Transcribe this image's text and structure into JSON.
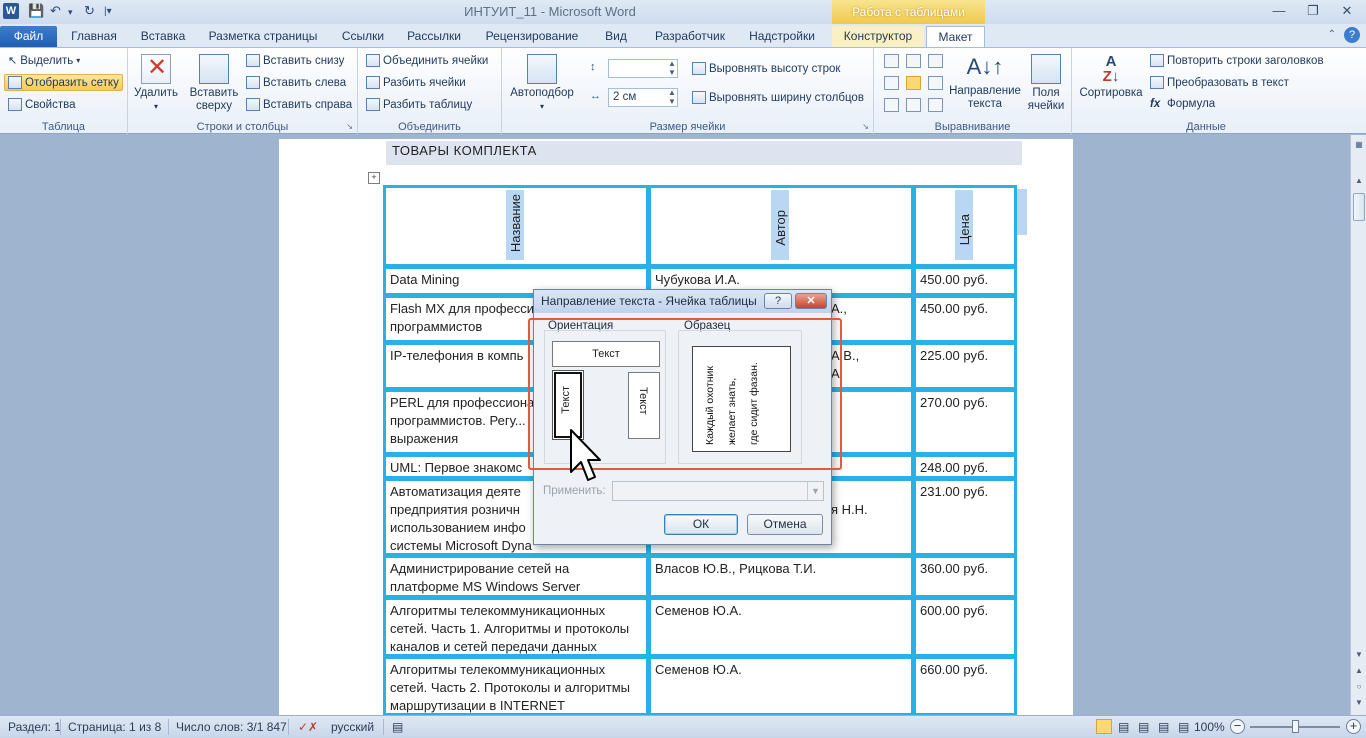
{
  "titlebar": {
    "app_icon": "W",
    "title": "ИНТУИТ_11  -  Microsoft Word",
    "context_tab": "Работа с таблицами",
    "qat_icons": [
      "save-icon",
      "undo-icon",
      "redo-icon",
      "customize-icon"
    ]
  },
  "tabs": {
    "file": "Файл",
    "home": "Главная",
    "insert": "Вставка",
    "layout_page": "Разметка страницы",
    "references": "Ссылки",
    "mailings": "Рассылки",
    "review": "Рецензирование",
    "view": "Вид",
    "developer": "Разработчик",
    "addins": "Надстройки",
    "design": "Конструктор",
    "layout": "Макет"
  },
  "ribbon": {
    "table": {
      "select": "Выделить",
      "gridlines": "Отобразить сетку",
      "properties": "Свойства",
      "label": "Таблица"
    },
    "rows_cols": {
      "delete": "Удалить",
      "insert_above_1": "Вставить",
      "insert_above_2": "сверху",
      "insert_below": "Вставить снизу",
      "insert_left": "Вставить слева",
      "insert_right": "Вставить справа",
      "label": "Строки и столбцы"
    },
    "merge": {
      "merge_cells": "Объединить ячейки",
      "split_cells": "Разбить ячейки",
      "split_table": "Разбить таблицу",
      "label": "Объединить"
    },
    "cell_size": {
      "autofit": "Автоподбор",
      "height_value": "",
      "width_value": "2 см",
      "distribute_rows": "Выровнять высоту строк",
      "distribute_cols": "Выровнять ширину столбцов",
      "label": "Размер ячейки"
    },
    "alignment": {
      "text_direction_1": "Направление",
      "text_direction_2": "текста",
      "margins_1": "Поля",
      "margins_2": "ячейки",
      "label": "Выравнивание"
    },
    "data": {
      "sort": "Сортировка",
      "repeat_header": "Повторить строки заголовков",
      "convert": "Преобразовать в текст",
      "formula": "Формула",
      "label": "Данные"
    }
  },
  "document": {
    "heading": "ТОВАРЫ КОМПЛЕКТА",
    "headers": [
      "Название",
      "Автор",
      "Цена"
    ],
    "rows": [
      {
        "name": "Data Mining",
        "author": "Чубукова И.А.",
        "price": "450.00 руб."
      },
      {
        "name": "Flash MX для професси... программистов",
        "author": "...",
        "price": "450.00 руб."
      },
      {
        "name": "IP-телефония в компь...",
        "author": "...А.В., ...А.",
        "price": "225.00 руб."
      },
      {
        "name": "PERL для профессиона... программистов. Регу... выражения",
        "author": "",
        "price": "270.00 руб."
      },
      {
        "name": "UML: Первое знакомс...",
        "author": "",
        "price": "248.00 руб."
      },
      {
        "name": "Автоматизация деяте... предприятия розничн... использованием инфо... системы Microsoft Dyna...",
        "author": "... ...я Н.Н.",
        "price": "231.00 руб."
      },
      {
        "name": "Администрирование сетей на платформе MS Windows Server",
        "author": "Власов Ю.В., Рицкова Т.И.",
        "price": "360.00 руб."
      },
      {
        "name": "Алгоритмы телекоммуникационных сетей. Часть 1. Алгоритмы и протоколы каналов и сетей передачи данных",
        "author": "Семенов Ю.А.",
        "price": "600.00 руб."
      },
      {
        "name": "Алгоритмы телекоммуникационных сетей. Часть 2. Протоколы и алгоритмы маршрутизации в INTERNET",
        "author": "Семенов Ю.А.",
        "price": "660.00 руб."
      }
    ],
    "cells": {
      "r1_name": "Data Mining",
      "r1_author": "Чубукова И.А.",
      "r1_price": "450.00 руб.",
      "r2_name_1": "Flash MX для професси",
      "r2_name_2": "программистов",
      "r2_author": "А.,",
      "r2_price": "450.00 руб.",
      "r3_name": "IP-телефония в компь",
      "r3_author_1": "А.В.,",
      "r3_author_2": "А.",
      "r3_price": "225.00 руб.",
      "r4_name_1": "PERL для профессиона",
      "r4_name_2": "программистов. Регу...",
      "r4_name_3": "выражения",
      "r4_price": "270.00 руб.",
      "r5_name": "UML: Первое знакомс",
      "r5_price": "248.00 руб.",
      "r6_name_1": "Автоматизация деяте",
      "r6_name_2": "предприятия розничн",
      "r6_name_3": "использованием инфо",
      "r6_name_4": "системы Microsoft Dyna",
      "r6_author_1": "",
      "r6_author_2": "я Н.Н.",
      "r6_price": "231.00 руб.",
      "r7_name_1": "Администрирование сетей на",
      "r7_name_2": "платформе MS Windows Server",
      "r7_author": "Власов Ю.В., Рицкова Т.И.",
      "r7_price": "360.00 руб.",
      "r8_name_1": "Алгоритмы телекоммуникационных",
      "r8_name_2": "сетей. Часть 1. Алгоритмы и протоколы",
      "r8_name_3": "каналов и сетей передачи данных",
      "r8_author": "Семенов Ю.А.",
      "r8_price": "600.00 руб.",
      "r9_name_1": "Алгоритмы телекоммуникационных",
      "r9_name_2": "сетей. Часть 2. Протоколы и алгоритмы",
      "r9_name_3": "маршрутизации в INTERNET",
      "r9_author": "Семенов Ю.А.",
      "r9_price": "660.00 руб."
    }
  },
  "dialog": {
    "title": "Направление текста - Ячейка таблицы",
    "help": "?",
    "close": "✕",
    "orientation_label": "Ориентация",
    "sample_label": "Образец",
    "option_text": "Текст",
    "sample_line_1": "Каждый охотник",
    "sample_line_2": "желает знать,",
    "sample_line_3": "где сидит фазан.",
    "apply_label": "Применить:",
    "ok": "ОК",
    "cancel": "Отмена"
  },
  "statusbar": {
    "section": "Раздел: 1",
    "page": "Страница: 1 из 8",
    "words": "Число слов: 3/1 847",
    "language": "русский",
    "zoom": "100%"
  }
}
